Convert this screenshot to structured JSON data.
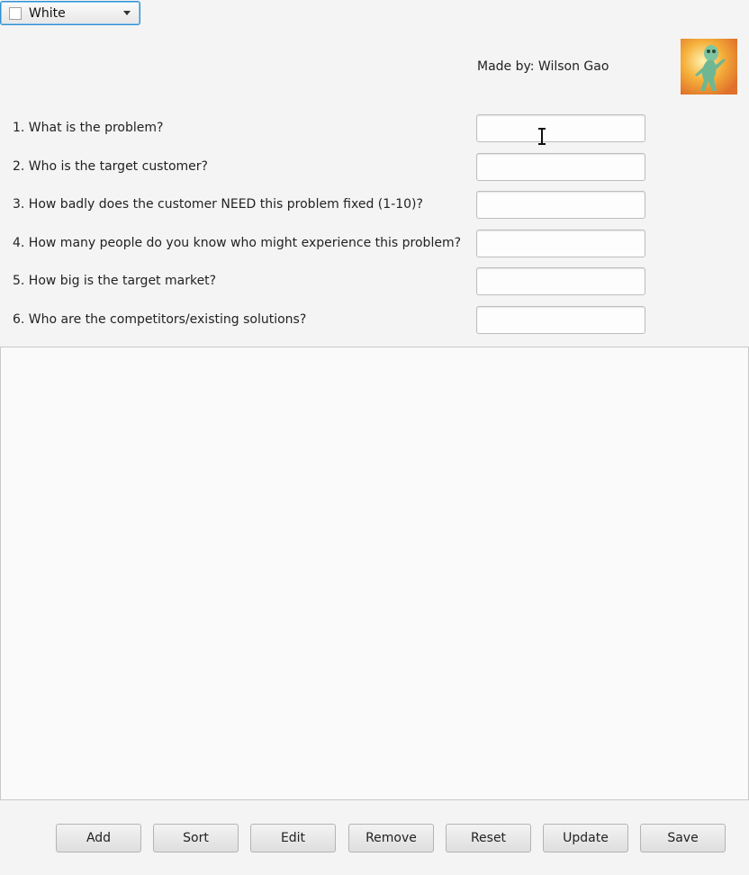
{
  "color_picker": {
    "selected": "White",
    "swatch_color": "#ffffff"
  },
  "author": {
    "credit": "Made by: Wilson Gao"
  },
  "questions": [
    {
      "label": "1. What is the problem?",
      "value": ""
    },
    {
      "label": "2. Who is the target customer?",
      "value": ""
    },
    {
      "label": "3. How badly does the customer NEED this problem fixed (1-10)?",
      "value": ""
    },
    {
      "label": "4. How many people do you know who might experience this problem?",
      "value": ""
    },
    {
      "label": "5. How big is the target market?",
      "value": ""
    },
    {
      "label": "6. Who are the competitors/existing solutions?",
      "value": ""
    }
  ],
  "list": {
    "items": []
  },
  "buttons": {
    "add": "Add",
    "sort": "Sort",
    "edit": "Edit",
    "remove": "Remove",
    "reset": "Reset",
    "update": "Update",
    "save": "Save"
  },
  "colors": {
    "focus_border": "#2f8fd0",
    "background": "#f4f4f4"
  }
}
